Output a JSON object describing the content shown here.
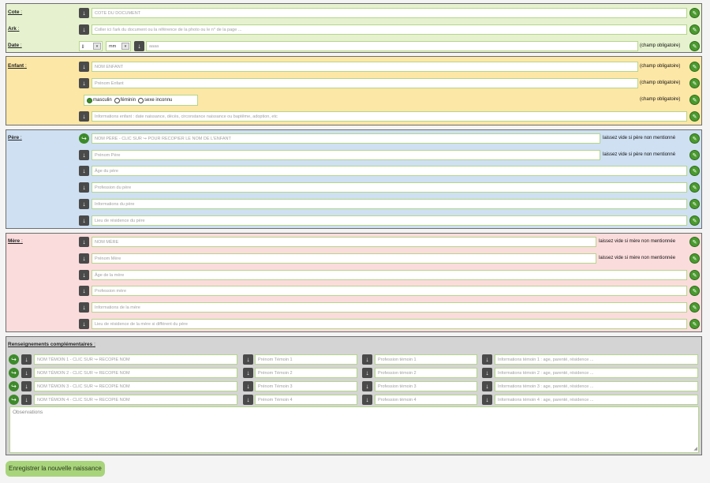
{
  "doc": {
    "cote_label": "Cote",
    "cote_placeholder": "COTE DU DOCUMENT",
    "ark_label": "Ark",
    "ark_placeholder": "Coller ici l'ark du document ou la référence de la photo ou le n° de la page ...",
    "date_label": "Date",
    "day_value": "jj",
    "month_value": "mm",
    "year_placeholder": "aaaa",
    "required": "(champ obligatoire)"
  },
  "child": {
    "label": "Enfant",
    "nom_placeholder": "NOM ENFANT",
    "prenom_placeholder": "Prénom Enfant",
    "sex_options": [
      "masculin",
      "féminin",
      "sexe inconnu"
    ],
    "info_placeholder": "Informations enfant : date naissance, décès, circonstance naissance ou baptême, adoption, etc",
    "required": "(champ obligatoire)"
  },
  "father": {
    "label": "Père",
    "nom_placeholder": "NOM PÈRE - CLIC SUR ↪ POUR RECOPIER LE NOM DE L'ENFANT",
    "prenom_placeholder": "Prénom Père",
    "age_placeholder": "Âge du père",
    "profession_placeholder": "Profession du père",
    "info_placeholder": "Informations du père",
    "residence_placeholder": "Lieu de résidence du père",
    "note": "laissez vide si père non mentionné"
  },
  "mother": {
    "label": "Mère",
    "nom_placeholder": "NOM MÈRE",
    "prenom_placeholder": "Prénom Mère",
    "age_placeholder": "Âge de la mère",
    "profession_placeholder": "Profession mère",
    "info_placeholder": "Informations de la mère",
    "residence_placeholder": "Lieu de résidence de la mère si différent du père",
    "note": "laissez vide si mère non mentionnée"
  },
  "extra": {
    "label": "Renseignements complémentaires",
    "witnesses": [
      {
        "nom": "NOM TÉMOIN 1 - CLIC SUR ↪ RECOPIE NOM",
        "prenom": "Prénom Témoin 1",
        "profession": "Profession témoin 1",
        "info": "Informations témoin 1 : age, parenté, résidence ..."
      },
      {
        "nom": "NOM TÉMOIN 2 - CLIC SUR ↪ RECOPIE NOM",
        "prenom": "Prénom Témoin 2",
        "profession": "Profession témoin 2",
        "info": "Informations témoin 2 : age, parenté, résidence ..."
      },
      {
        "nom": "NOM TÉMOIN 3 - CLIC SUR ↪ RECOPIE NOM",
        "prenom": "Prénom Témoin 3",
        "profession": "Profession témoin 3",
        "info": "Informations témoin 3 : age, parenté, résidence ..."
      },
      {
        "nom": "NOM TÉMOIN 4 - CLIC SUR ↪ RECOPIE NOM",
        "prenom": "Prénom Témoin 4",
        "profession": "Profession témoin 4",
        "info": "Informations témoin 4 : age, parenté, résidence ..."
      }
    ],
    "observations_placeholder": "Observations"
  },
  "submit_label": "Enregistrer la nouvelle naissance",
  "icons": {
    "down": "arrow-down-icon",
    "copy": "copy-name-icon",
    "erase": "eraser-icon"
  },
  "colors": {
    "doc_bg": "#e6f2cf",
    "child_bg": "#fde7a6",
    "father_bg": "#cfe0f2",
    "mother_bg": "#fbdcdc",
    "extra_bg": "#d4d4d4",
    "accent": "#4a9a2e"
  }
}
